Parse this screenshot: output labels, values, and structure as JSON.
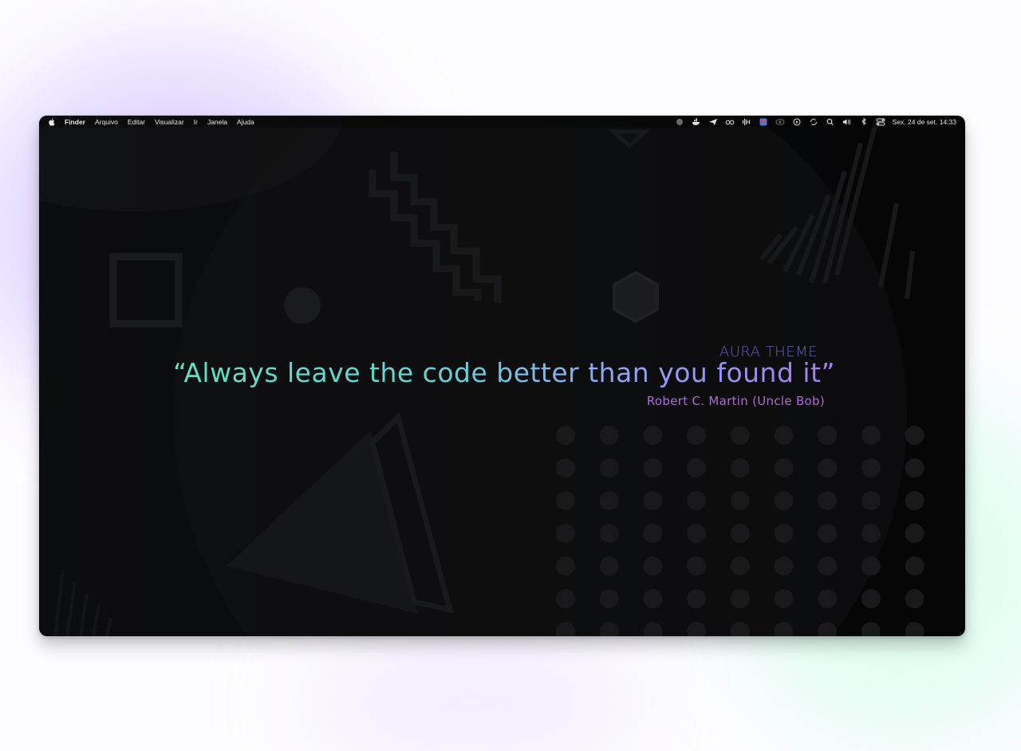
{
  "menubar": {
    "app_name": "Finder",
    "items": [
      "Arquivo",
      "Editar",
      "Visualizar",
      "Ir",
      "Janela",
      "Ajuda"
    ],
    "status_icons": [
      "record-icon",
      "docker-icon",
      "paper-plane-icon",
      "glasses-icon",
      "audio-waveform-icon",
      "app-badge-icon",
      "creative-cloud-icon",
      "play-icon",
      "sync-icon",
      "search-icon",
      "volume-icon",
      "bluetooth-icon",
      "control-center-icon"
    ],
    "clock": "Sex. 24 de set.  14:33"
  },
  "wallpaper": {
    "theme_label": "AURA THEME",
    "quote": "“Always leave the code better than you found it”",
    "author": "Robert C. Martin (Uncle Bob)"
  },
  "colors": {
    "quote_start": "#5fe0c1",
    "quote_end": "#a47cf6",
    "theme_label": "#6b5cc2",
    "author": "#b06ad6",
    "background": "#0a0a0b"
  }
}
